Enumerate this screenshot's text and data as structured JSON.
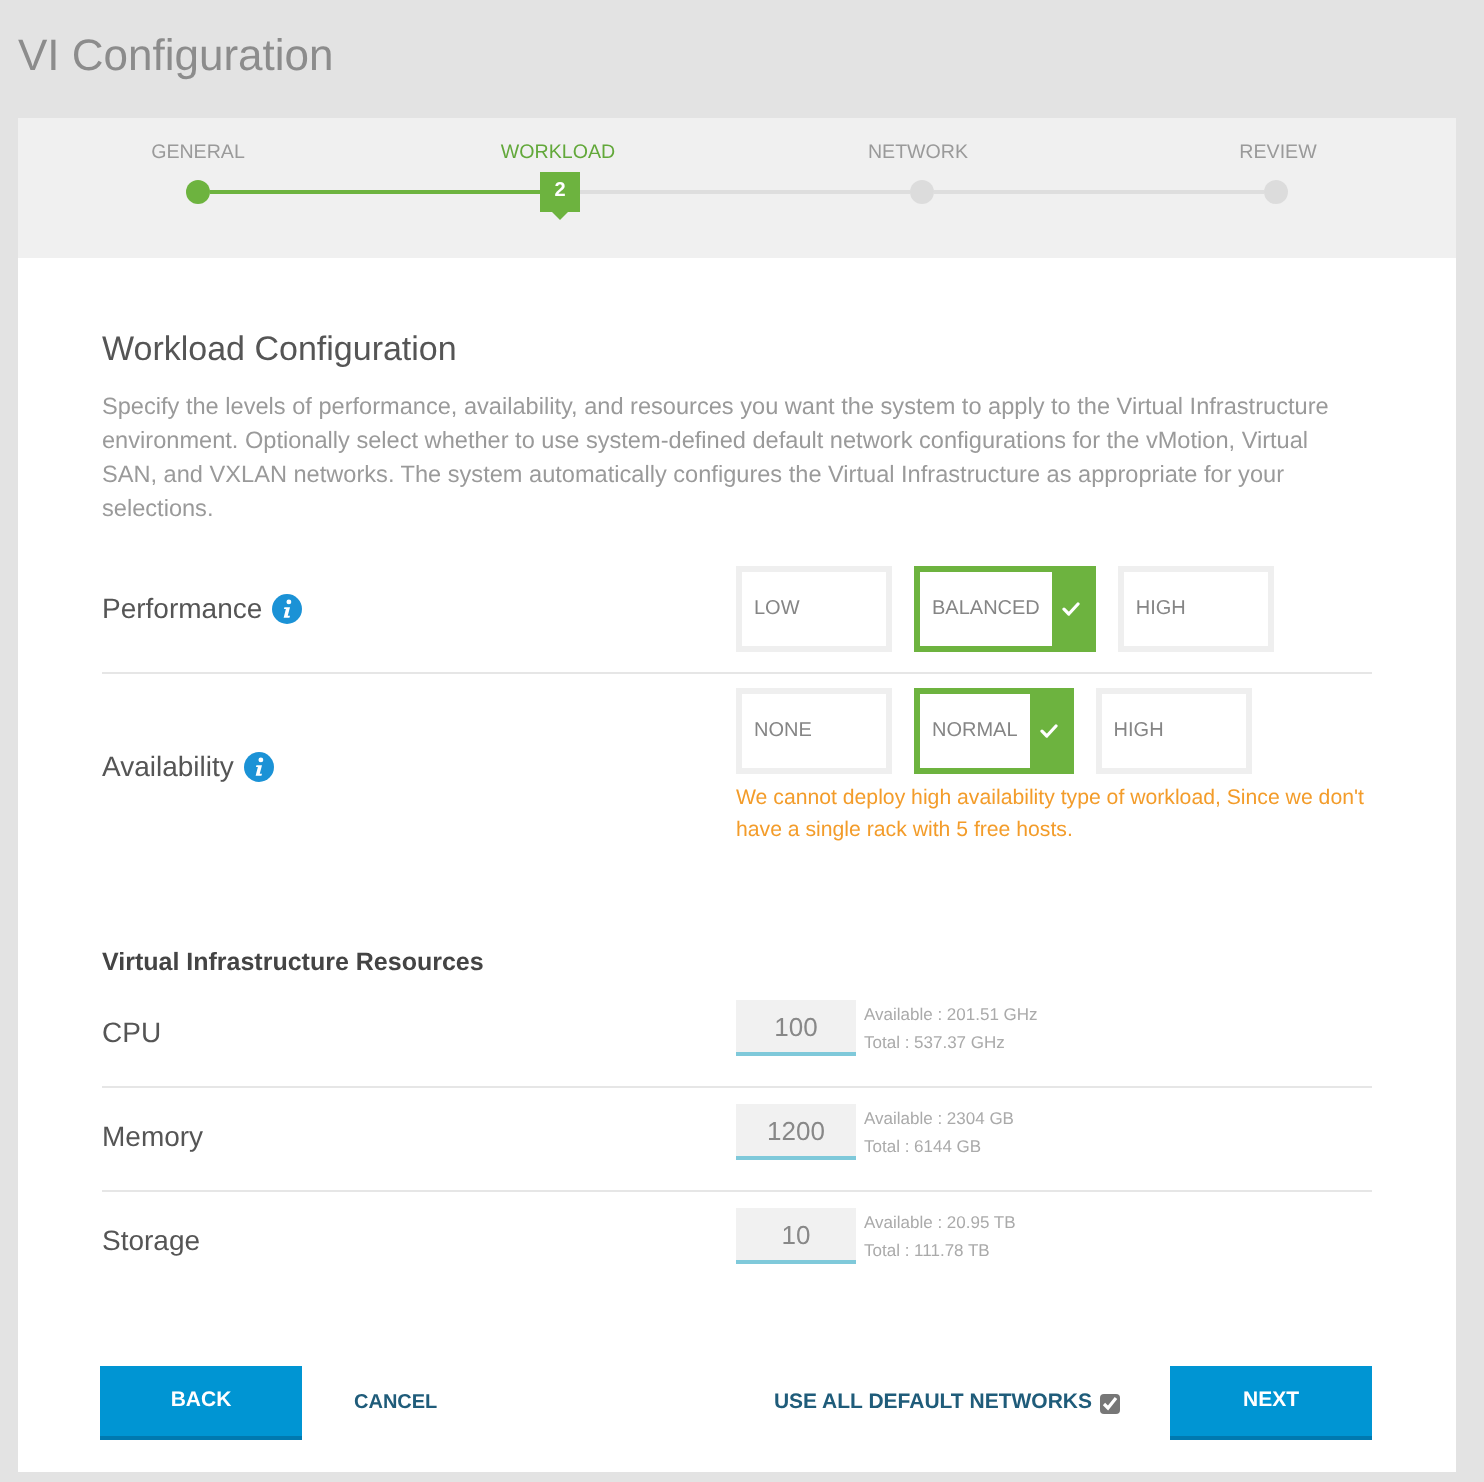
{
  "page": {
    "title": "VI Configuration"
  },
  "stepper": {
    "steps": [
      {
        "label": "GENERAL",
        "completed": true,
        "current": false
      },
      {
        "label": "WORKLOAD",
        "completed": false,
        "current": true,
        "number": "2"
      },
      {
        "label": "NETWORK",
        "completed": false,
        "current": false
      },
      {
        "label": "REVIEW",
        "completed": false,
        "current": false
      }
    ]
  },
  "section": {
    "heading": "Workload Configuration",
    "description": "Specify the levels of performance, availability, and resources you want the system to apply to the Virtual Infrastructure environment. Optionally select whether to use system-defined default network configurations for the vMotion, Virtual SAN, and VXLAN networks. The system automatically configures the Virtual Infrastructure as appropriate for your selections."
  },
  "option_groups": [
    {
      "label": "Performance",
      "info": true,
      "options": [
        {
          "label": "LOW",
          "selected": false
        },
        {
          "label": "BALANCED",
          "selected": true
        },
        {
          "label": "HIGH",
          "selected": false
        }
      ]
    },
    {
      "label": "Availability",
      "info": true,
      "options": [
        {
          "label": "NONE",
          "selected": false
        },
        {
          "label": "NORMAL",
          "selected": true
        },
        {
          "label": "HIGH",
          "selected": false
        }
      ],
      "warning": "We cannot deploy high availability type of workload, Since we don't have a single rack with 5 free hosts."
    }
  ],
  "resources": {
    "heading": "Virtual Infrastructure Resources",
    "rows": [
      {
        "label": "CPU",
        "value": "100",
        "available": "Available : 201.51 GHz",
        "total": "Total : 537.37 GHz"
      },
      {
        "label": "Memory",
        "value": "1200",
        "available": "Available : 2304 GB",
        "total": "Total : 6144 GB"
      },
      {
        "label": "Storage",
        "value": "10",
        "available": "Available : 20.95 TB",
        "total": "Total : 111.78 TB"
      }
    ]
  },
  "footer": {
    "back": "BACK",
    "cancel": "CANCEL",
    "default_networks": {
      "label": "USE ALL DEFAULT NETWORKS",
      "checked": true
    },
    "next": "NEXT"
  }
}
